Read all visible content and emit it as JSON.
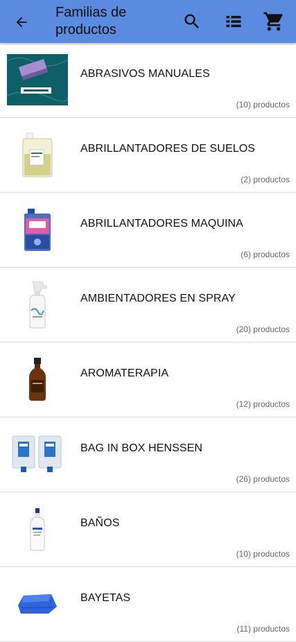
{
  "appbar": {
    "title_line1": "Familias de",
    "title_line2": "productos",
    "back_icon": "arrow-back-icon",
    "search_icon": "search-icon",
    "list_icon": "list-view-icon",
    "cart_icon": "shopping-cart-icon"
  },
  "colors": {
    "appbar": "#5b8be0",
    "divider": "#dddddd",
    "count_text": "#666666"
  },
  "families": [
    {
      "name": "ABRASIVOS MANUALES",
      "count": "(10) productos",
      "icon": "sponge-box-icon"
    },
    {
      "name": "ABRILLANTADORES DE SUELOS",
      "count": "(2) productos",
      "icon": "jerrycan-icon"
    },
    {
      "name": "ABRILLANTADORES MAQUINA",
      "count": "(6) productos",
      "icon": "detergent-bottle-icon"
    },
    {
      "name": "AMBIENTADORES EN SPRAY",
      "count": "(20) productos",
      "icon": "spray-bottle-icon"
    },
    {
      "name": "AROMATERAPIA",
      "count": "(12) productos",
      "icon": "amber-bottle-icon"
    },
    {
      "name": "BAG IN BOX HENSSEN",
      "count": "(26) productos",
      "icon": "dispenser-icon"
    },
    {
      "name": "BAÑOS",
      "count": "(10) productos",
      "icon": "white-bottle-icon"
    },
    {
      "name": "BAYETAS",
      "count": "(11) productos",
      "icon": "blue-cloth-icon"
    }
  ]
}
